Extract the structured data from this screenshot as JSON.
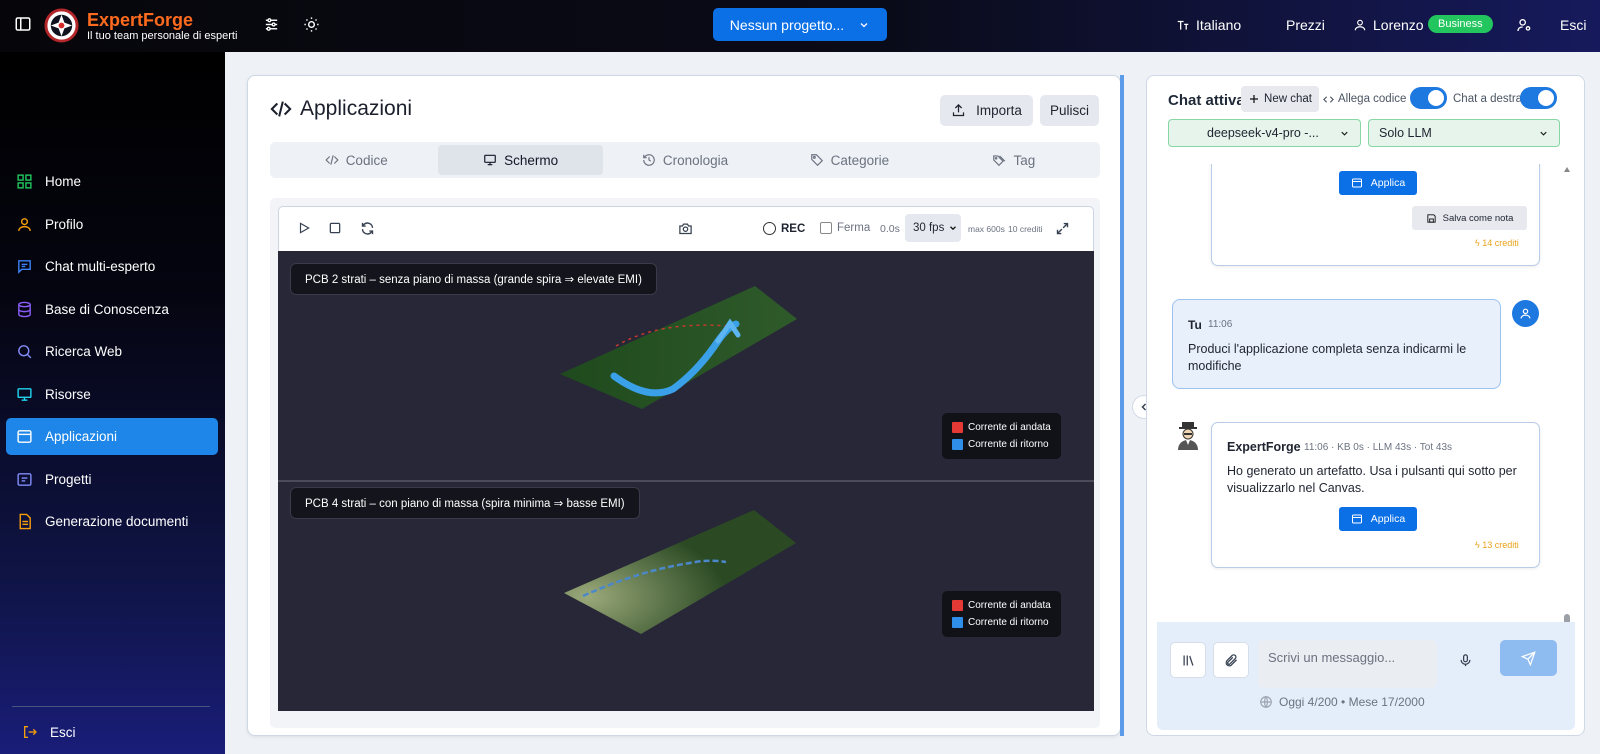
{
  "app": {
    "name": "ExpertForge",
    "tagline": "Il tuo team personale di esperti"
  },
  "header": {
    "project_select": "Nessun progetto...",
    "language": "Italiano",
    "pricing": "Prezzi",
    "user": "Lorenzo",
    "plan_badge": "Business",
    "logout": "Esci"
  },
  "sidebar": {
    "items": [
      {
        "label": "Home",
        "icon": "home-icon",
        "color": "#22c55e"
      },
      {
        "label": "Profilo",
        "icon": "user-icon",
        "color": "#f59e0b"
      },
      {
        "label": "Chat multi-esperto",
        "icon": "chat-icon",
        "color": "#3b82f6"
      },
      {
        "label": "Base di Conoscenza",
        "icon": "database-icon",
        "color": "#8b5cf6"
      },
      {
        "label": "Ricerca Web",
        "icon": "search-icon",
        "color": "#818cf8"
      },
      {
        "label": "Risorse",
        "icon": "monitor-icon",
        "color": "#22d3ee"
      },
      {
        "label": "Applicazioni",
        "icon": "app-window-icon",
        "color": "#ffffff"
      },
      {
        "label": "Progetti",
        "icon": "folder-icon",
        "color": "#818cf8"
      },
      {
        "label": "Generazione documenti",
        "icon": "document-icon",
        "color": "#f59e0b"
      }
    ],
    "active_index": 6,
    "logout": "Esci"
  },
  "panel": {
    "title": "Applicazioni",
    "import_label": "Importa",
    "clear_label": "Pulisci",
    "tabs": [
      {
        "label": "Codice",
        "icon": "code-icon"
      },
      {
        "label": "Schermo",
        "icon": "monitor-icon"
      },
      {
        "label": "Cronologia",
        "icon": "history-icon"
      },
      {
        "label": "Categorie",
        "icon": "tag-icon"
      },
      {
        "label": "Tag",
        "icon": "tags-icon"
      }
    ],
    "active_tab": 1
  },
  "viewer": {
    "rec_label": "REC",
    "stop_label": "Ferma",
    "time": "0.0s",
    "fps": "30 fps",
    "max": "max 600s",
    "credits": "10 crediti",
    "scene_top_label": "PCB 2 strati – senza piano di massa (grande spira ⇒ elevate EMI)",
    "scene_bottom_label": "PCB 4 strati – con piano di massa (spira minima ⇒ basse EMI)",
    "legend": [
      {
        "label": "Corrente di andata",
        "color": "#e53935"
      },
      {
        "label": "Corrente di ritorno",
        "color": "#2f8fe8"
      }
    ]
  },
  "chat": {
    "title": "Chat attiva",
    "new_chat": "New chat",
    "attach_code": "Allega codice",
    "chat_right": "Chat a destra",
    "model": "deepseek-v4-pro -...",
    "mode": "Solo LLM",
    "messages": {
      "prev_apply": "Applica",
      "prev_save_note": "Salva come nota",
      "prev_credits": "14 crediti",
      "user_name": "Tu",
      "user_time": "11:06",
      "user_text": "Produci l'applicazione completa senza indicarmi le modifiche",
      "ai_name": "ExpertForge",
      "ai_meta": "11:06 · KB 0s · LLM 43s · Tot 43s",
      "ai_text": "Ho generato un artefatto. Usa i pulsanti qui sotto per visualizzarlo nel Canvas.",
      "ai_apply": "Applica",
      "ai_credits": "13 crediti"
    },
    "input_placeholder": "Scrivi un messaggio...",
    "quota": "Oggi 4/200 • Mese 17/2000"
  }
}
